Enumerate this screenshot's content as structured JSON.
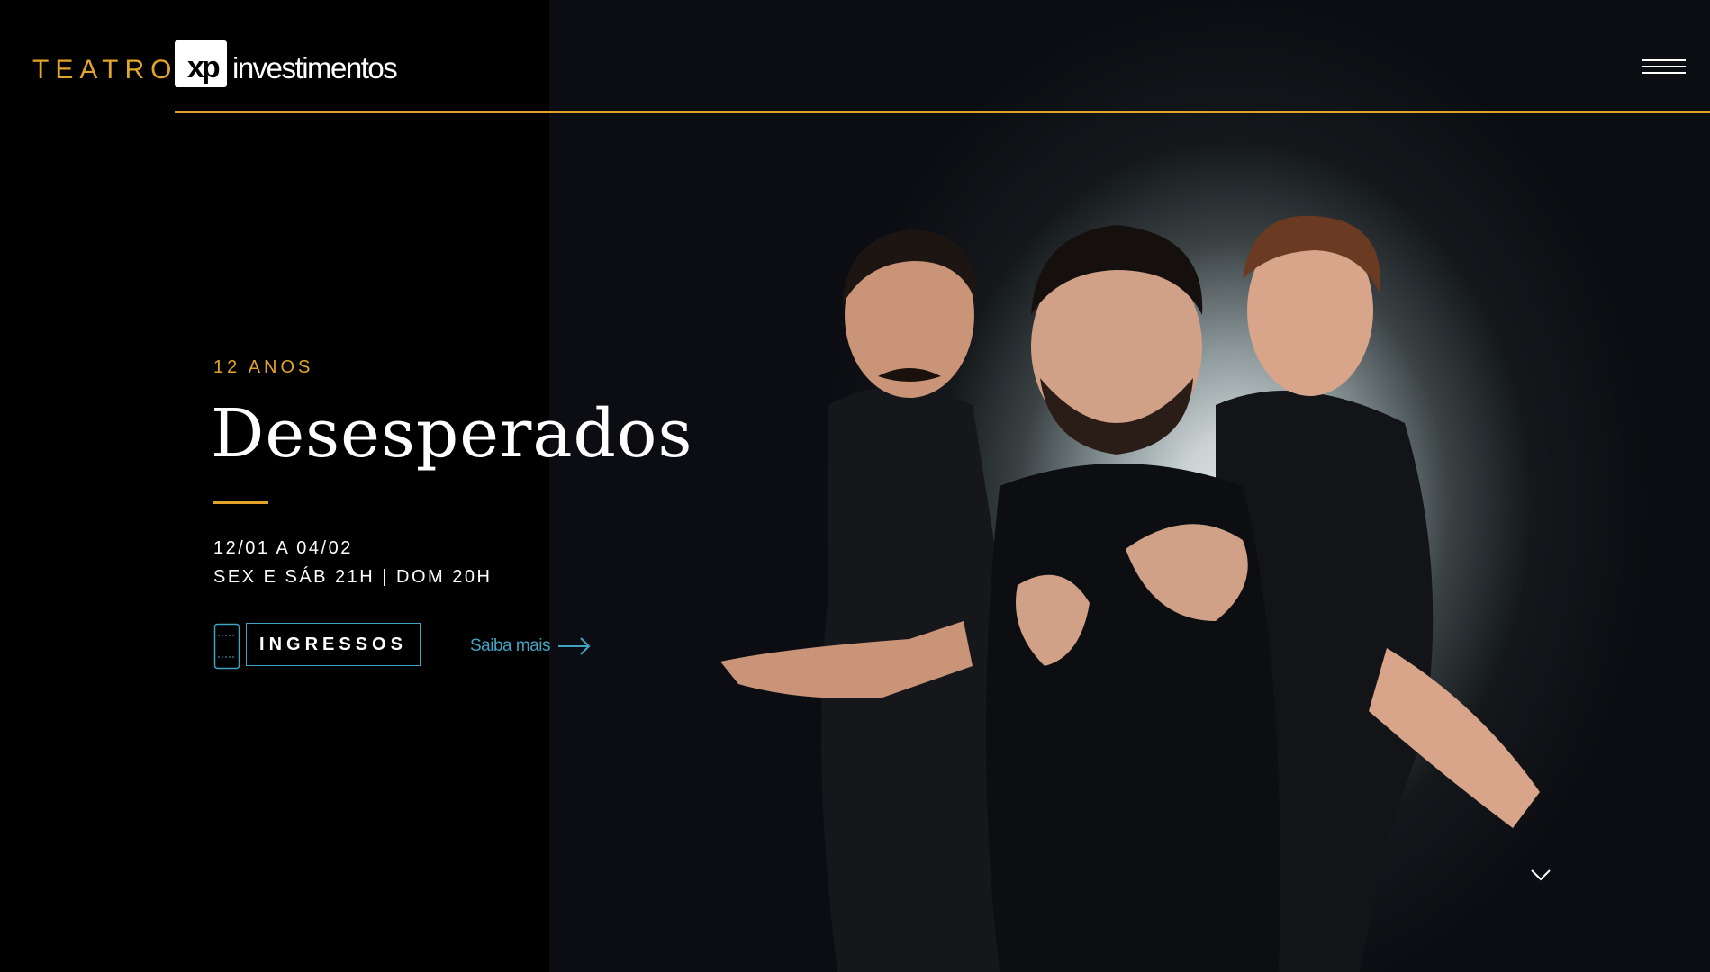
{
  "header": {
    "logo_teatro": "TEATRO",
    "logo_xp": "xp",
    "logo_investimentos": "investimentos",
    "accent_color": "#e0a42a",
    "menu_icon": "hamburger-icon"
  },
  "hero": {
    "age_rating": "12 ANOS",
    "title": "Desesperados",
    "dates": "12/01 A 04/02",
    "times": "SEX E SÁB 21H | DOM 20H",
    "tickets_label": "INGRESSOS",
    "tickets_icon": "ticket-icon",
    "more_label": "Saiba mais",
    "more_icon": "arrow-right-icon",
    "link_color": "#3fa4c4",
    "scroll_icon": "chevron-down-icon"
  }
}
